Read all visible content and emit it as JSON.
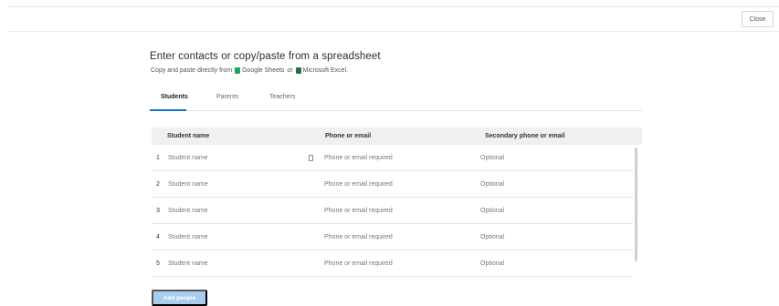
{
  "header": {
    "close_label": "Close"
  },
  "main": {
    "title": "Enter contacts or copy/paste from a spreadsheet",
    "subtitle_prefix": "Copy and paste directly from",
    "sheets_label": "Google Sheets",
    "or_text": "or",
    "excel_label": "Microsoft Excel."
  },
  "tabs": [
    {
      "label": "Students",
      "active": true
    },
    {
      "label": "Parents",
      "active": false
    },
    {
      "label": "Teachers",
      "active": false
    }
  ],
  "table": {
    "columns": [
      "Student name",
      "Phone or email",
      "Secondary phone or email"
    ],
    "rows": [
      {
        "num": "1",
        "name": "Student name",
        "phone": "Phone or email required",
        "secondary": "Optional"
      },
      {
        "num": "2",
        "name": "Student name",
        "phone": "Phone or email required",
        "secondary": "Optional"
      },
      {
        "num": "3",
        "name": "Student name",
        "phone": "Phone or email required",
        "secondary": "Optional"
      },
      {
        "num": "4",
        "name": "Student name",
        "phone": "Phone or email required",
        "secondary": "Optional"
      },
      {
        "num": "5",
        "name": "Student name",
        "phone": "Phone or email required",
        "secondary": "Optional"
      }
    ]
  },
  "footer": {
    "add_label": "Add people"
  },
  "colors": {
    "accent": "#1a73c9",
    "button_disabled": "#a9cdee",
    "sheets": "#1fa463",
    "excel": "#217346"
  },
  "icons": {
    "sheets": "google-sheets-icon",
    "excel": "excel-icon",
    "paste": "paste-icon"
  }
}
